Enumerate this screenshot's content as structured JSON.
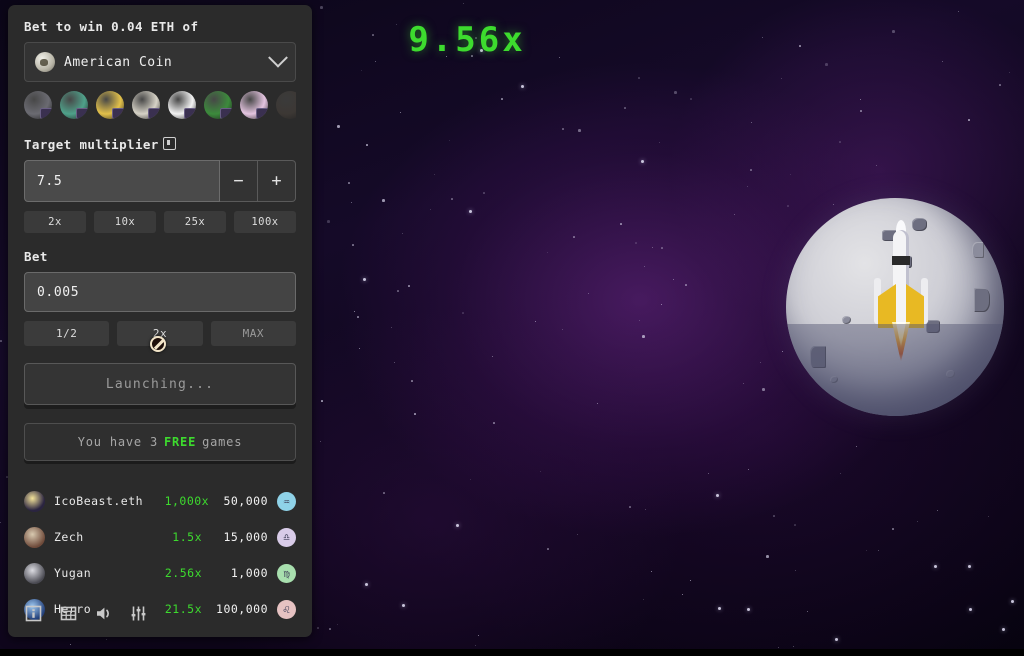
{
  "game": {
    "multiplier_display": "9.56x",
    "multiplier_color": "#3ddb2e",
    "rocket_icon": "rocket-icon",
    "moon_icon": "moon-icon",
    "background": "space-nebula"
  },
  "panel": {
    "header_label": "Bet to win 0.04 ETH of",
    "coin_select": {
      "value": "American Coin",
      "chevron_icon": "chevron-down-icon",
      "avatar_icon": "coin-avatar-icon"
    },
    "coin_thumbnails": [
      {
        "name": "coin-thumb-1",
        "color": "#6b6b72"
      },
      {
        "name": "coin-thumb-2",
        "color": "#4fa18a"
      },
      {
        "name": "coin-thumb-3",
        "color": "#e3c14a"
      },
      {
        "name": "coin-thumb-4",
        "color": "#d6d2c6"
      },
      {
        "name": "coin-thumb-5",
        "color": "#f2f2f2"
      },
      {
        "name": "coin-thumb-6",
        "color": "#3c8b3c"
      },
      {
        "name": "coin-thumb-7",
        "color": "#e4c4e0"
      },
      {
        "name": "coin-thumb-8",
        "color": "#4a423c"
      }
    ],
    "target_multiplier": {
      "label": "Target multiplier",
      "info_icon": "info-icon",
      "value": "7.5",
      "decrement_label": "−",
      "increment_label": "+",
      "presets": [
        "2x",
        "10x",
        "25x",
        "100x"
      ]
    },
    "bet": {
      "label": "Bet",
      "value": "0.005",
      "presets": [
        "1/2",
        "2x",
        "MAX"
      ]
    },
    "launch_button": {
      "label": "Launching...",
      "state": "disabled",
      "cursor_icon": "not-allowed-cursor-icon"
    },
    "free_games": {
      "prefix": "You have 3",
      "highlight": "FREE",
      "suffix": "games"
    },
    "leaderboard": [
      {
        "avatar": "avatar-icobeast",
        "name": "IcoBeast.eth",
        "multiplier": "1,000x",
        "amount": "50,000",
        "zodiac": "aquarius-badge",
        "zodiac_glyph": "♒",
        "zodiac_color": "#8fd2e8"
      },
      {
        "avatar": "avatar-zech",
        "name": "Zech",
        "multiplier": "1.5x",
        "amount": "15,000",
        "zodiac": "libra-badge",
        "zodiac_glyph": "♎",
        "zodiac_color": "#d8cbe8"
      },
      {
        "avatar": "avatar-yugan",
        "name": "Yugan",
        "multiplier": "2.56x",
        "amount": "1,000",
        "zodiac": "virgo-badge",
        "zodiac_glyph": "♍",
        "zodiac_color": "#a8dfae"
      },
      {
        "avatar": "avatar-herro",
        "name": "Herro",
        "multiplier": "21.5x",
        "amount": "100,000",
        "zodiac": "leo-badge",
        "zodiac_glyph": "♌",
        "zodiac_color": "#e6c2c2"
      }
    ],
    "footer_icons": [
      {
        "name": "info-panel-icon"
      },
      {
        "name": "leaderboard-grid-icon"
      },
      {
        "name": "sound-icon"
      },
      {
        "name": "settings-sliders-icon"
      }
    ]
  }
}
